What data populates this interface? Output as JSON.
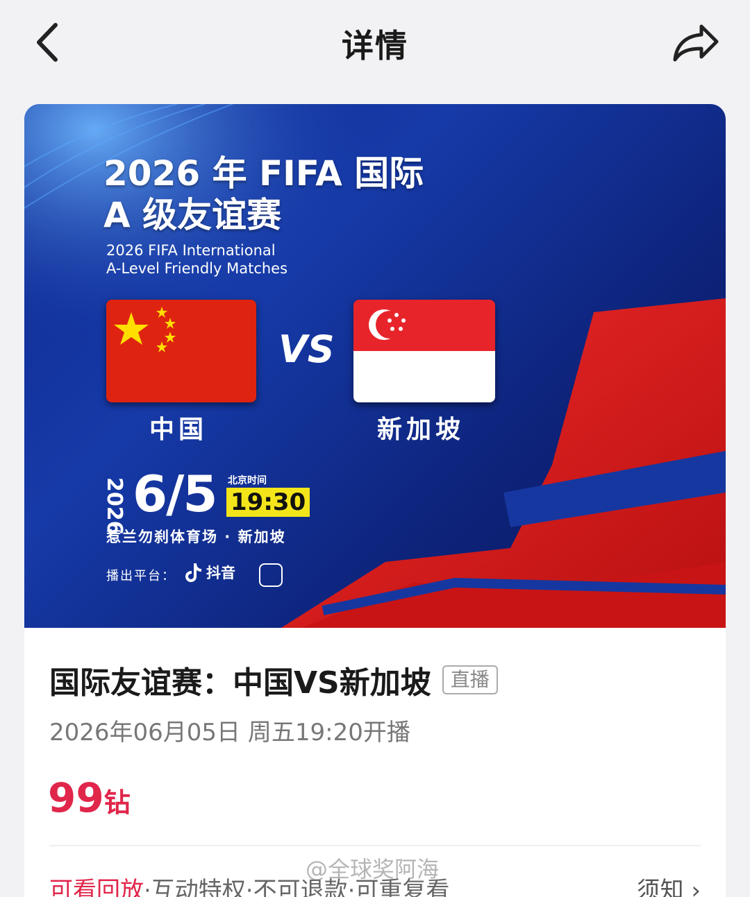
{
  "header": {
    "back_icon": "chevron-left-icon",
    "title": "详情",
    "share_icon": "share-arrow-icon"
  },
  "poster": {
    "title_cn_line1": "2026 年 FIFA 国际",
    "title_cn_line2": "A 级友谊赛",
    "title_en_line1": "2026 FIFA International",
    "title_en_line2": "A-Level Friendly Matches",
    "vs": "VS",
    "team_home": "中国",
    "team_away": "新加坡",
    "year": "2026",
    "date": "6/5",
    "time_zone_label": "北京时间",
    "time": "19:30",
    "venue": "惹兰勿刹体育场 · 新加坡",
    "platform_label": "播出平台：",
    "platform_name": "抖音",
    "colors": {
      "poster_bg": "#163aa8",
      "red_accent": "#e8242b",
      "time_highlight": "#f4e51a"
    }
  },
  "event": {
    "title": "国际友谊赛：中国VS新加坡",
    "badge": "直播",
    "start_time": "2026年06月05日 周五19:20开播",
    "price_number": "99",
    "price_unit": "钻",
    "perk_highlight": "可看回放",
    "perks_rest": "·互动特权·不可退款·可重复看",
    "notice_label": "须知",
    "accent_color": "#e0264a"
  },
  "watermark": "@全球奖阿海"
}
